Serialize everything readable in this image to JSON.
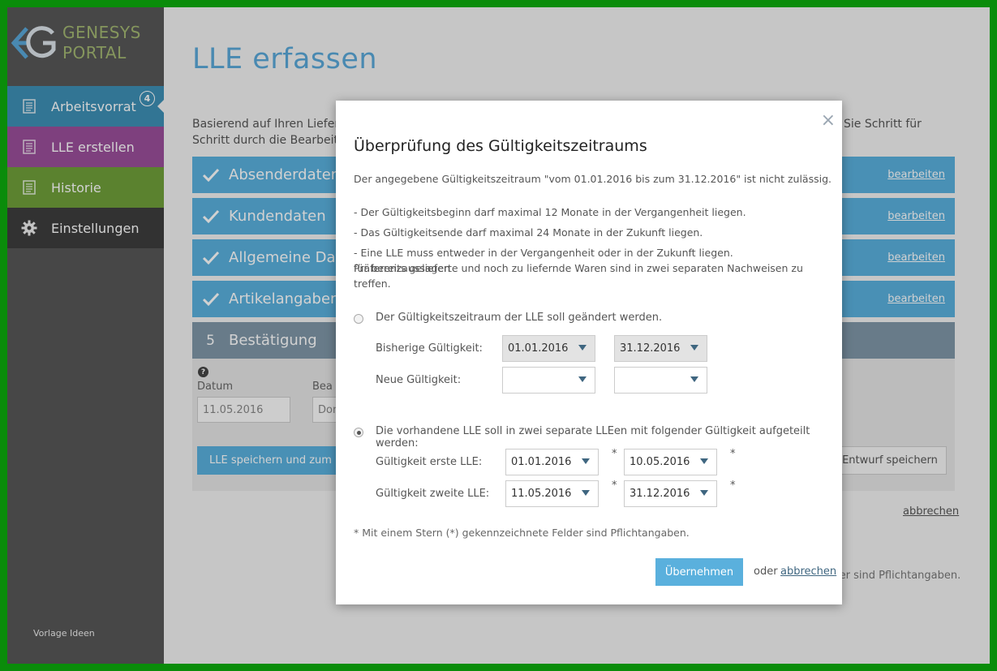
{
  "brand": {
    "line1": "GENESYS",
    "line2": "PORTAL"
  },
  "sidebar": {
    "items": [
      {
        "label": "Arbeitsvorrat",
        "badge": "4"
      },
      {
        "label": "LLE erstellen"
      },
      {
        "label": "Historie"
      },
      {
        "label": "Einstellungen"
      }
    ],
    "footer": "Vorlage Ideen"
  },
  "main": {
    "title": "LLE erfassen",
    "intro_left_1": "Basierend auf Ihren Liefer",
    "intro_left_2": "Schritt durch die Bearbeit",
    "intro_right": "Sie Schritt für",
    "steps": [
      {
        "label": "Absenderdaten",
        "edit": "bearbeiten"
      },
      {
        "label": "Kundendaten",
        "edit": "bearbeiten"
      },
      {
        "label": "Allgemeine Dat",
        "edit": "bearbeiten"
      },
      {
        "label": "Artikelangaben",
        "edit": "bearbeiten"
      }
    ],
    "confirm": {
      "number": "5",
      "label": "Bestätigung"
    },
    "date_label": "Datum",
    "date_value": "11.05.2016",
    "bea_label": "Bea",
    "bea_value": "Don",
    "save_button": "LLE speichern und zum Fr",
    "draft_button": "Entwurf speichern",
    "cancel": "abbrechen",
    "required_note": "ler sind Pflichtangaben."
  },
  "modal": {
    "title": "Überprüfung des Gültigkeitszeitraums",
    "message": "Der angegebene Gültigkeitszeitraum \"vom 01.01.2016 bis zum 31.12.2016\" ist nicht zulässig.",
    "rule1": "- Der Gültigkeitsbeginn darf maximal 12 Monate in der Vergangenheit liegen.",
    "rule2": "- Das Gültigkeitsende darf maximal 24 Monate in der Zukunft liegen.",
    "rule3_a": "- Eine LLE muss entweder in der Vergangenheit oder in der Zukunft liegen. Präferenzaussagen",
    "rule3_b": "für bereits gelieferte und noch zu liefernde Waren sind in zwei separaten Nachweisen zu treffen.",
    "option1": {
      "label": "Der Gültigkeitszeitraum der LLE soll geändert werden.",
      "selected": false,
      "current_label": "Bisherige Gültigkeit:",
      "current_from": "01.01.2016",
      "current_to": "31.12.2016",
      "new_label": "Neue Gültigkeit:",
      "new_from": "",
      "new_to": ""
    },
    "option2": {
      "label": "Die vorhandene LLE soll in zwei separate LLEen mit folgender Gültigkeit aufgeteilt werden:",
      "selected": true,
      "first_label": "Gültigkeit erste LLE:",
      "first_from": "01.01.2016",
      "first_to": "10.05.2016",
      "second_label": "Gültigkeit zweite LLE:",
      "second_from": "11.05.2016",
      "second_to": "31.12.2016",
      "star": "*"
    },
    "footnote": "* Mit einem Stern (*) gekennzeichnete Felder sind Pflichtangaben.",
    "apply": "Übernehmen",
    "or": "oder",
    "cancel": "abbrechen",
    "close": "×"
  },
  "colors": {
    "accent": "#5ab0dd",
    "nav1": "#3d8fb5",
    "nav2": "#9a4f9a",
    "nav3": "#6f9f3a",
    "brand_text": "#a3b872",
    "frame": "#0a8c0a"
  }
}
